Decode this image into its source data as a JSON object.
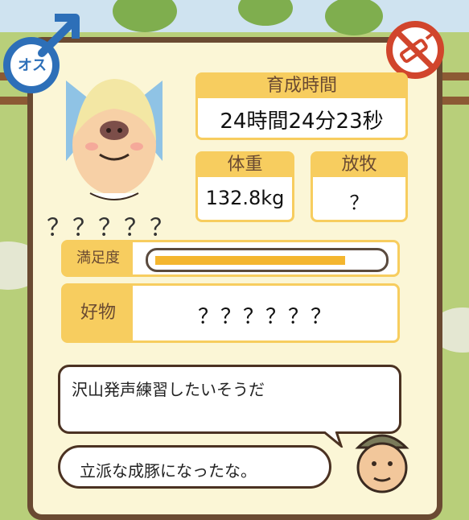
{
  "header": {
    "gender_label": "オス",
    "name": "？？？？？"
  },
  "stats": {
    "rearing_time_label": "育成時間",
    "rearing_time_value": "24時間24分23秒",
    "weight_label": "体重",
    "weight_value": "132.8kg",
    "grazing_label": "放牧",
    "grazing_value": "？"
  },
  "satisfaction": {
    "label": "満足度",
    "level": 0.9
  },
  "favorite": {
    "label": "好物",
    "value": "？？？？？？"
  },
  "dialogue": {
    "pig_message": "沢山発声練習したいそうだ",
    "farmer_message": "立派な成豚になったな。"
  },
  "colors": {
    "frame": "#6a4a32",
    "panel": "#fbf6d6",
    "accent": "#f7cd5f",
    "bar_fill": "#f4b62f",
    "male_blue": "#2d6fb8",
    "no_injection_red": "#d1452c"
  },
  "icons": {
    "gender": "male-symbol-icon",
    "status": "no-injection-icon"
  }
}
